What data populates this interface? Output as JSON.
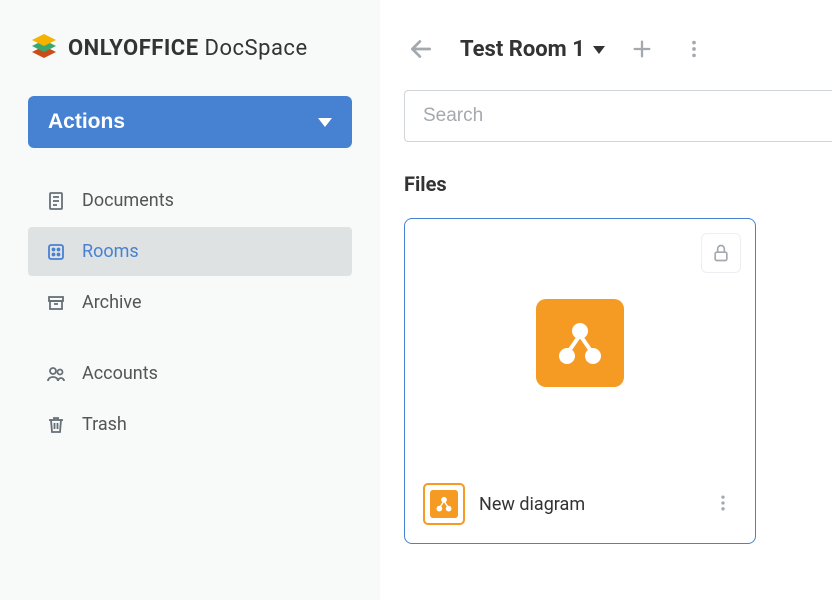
{
  "brand": {
    "name_strong": "ONLYOFFICE",
    "name_light": "DocSpace"
  },
  "sidebar": {
    "actions_label": "Actions",
    "items": [
      {
        "key": "documents",
        "label": "Documents",
        "icon": "document-icon",
        "active": false
      },
      {
        "key": "rooms",
        "label": "Rooms",
        "icon": "rooms-icon",
        "active": true
      },
      {
        "key": "archive",
        "label": "Archive",
        "icon": "archive-icon",
        "active": false
      },
      {
        "key": "accounts",
        "label": "Accounts",
        "icon": "accounts-icon",
        "active": false
      },
      {
        "key": "trash",
        "label": "Trash",
        "icon": "trash-icon",
        "active": false
      }
    ]
  },
  "header": {
    "room_title": "Test Room 1"
  },
  "search": {
    "placeholder": "Search"
  },
  "section": {
    "heading": "Files"
  },
  "files": [
    {
      "name": "New diagram",
      "type": "diagram",
      "locked": true
    }
  ]
}
